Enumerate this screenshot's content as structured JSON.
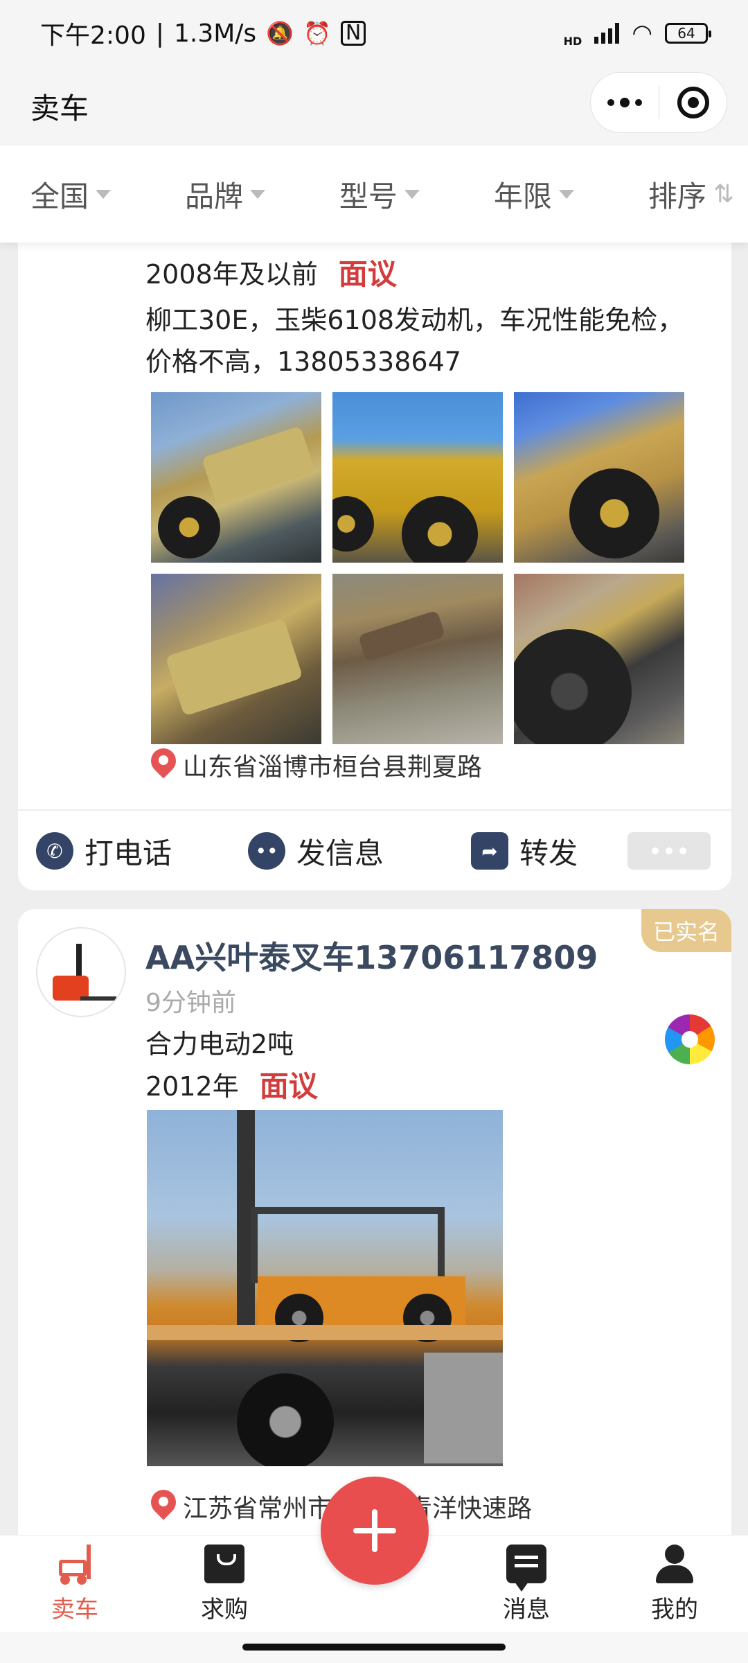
{
  "status_bar": {
    "time": "下午2:00",
    "speed": "1.3M/s",
    "hd": "HD",
    "battery": "64"
  },
  "title_bar": {
    "title": "卖车"
  },
  "filters": [
    {
      "label": "全国"
    },
    {
      "label": "品牌"
    },
    {
      "label": "型号"
    },
    {
      "label": "年限"
    },
    {
      "label": "排序"
    }
  ],
  "listings": [
    {
      "year": "2008年及以前",
      "price": "面议",
      "description": "柳工30E，玉柴6108发动机，车况性能免检，价格不高，13805338647",
      "location": "山东省淄博市桓台县荆夏路",
      "actions": {
        "call": "打电话",
        "message": "发信息",
        "share": "转发"
      }
    },
    {
      "badge": "已实名",
      "seller": "AA兴叶泰叉车13706117809",
      "time": "9分钟前",
      "model": "合力电动2吨",
      "year": "2012年",
      "price": "面议",
      "location": "江苏省常州市武进区青洋快速路"
    }
  ],
  "tab_bar": [
    {
      "label": "卖车",
      "icon": "forklift-icon",
      "active": true
    },
    {
      "label": "求购",
      "icon": "bag-icon"
    },
    {
      "label": "消息",
      "icon": "message-icon"
    },
    {
      "label": "我的",
      "icon": "user-icon"
    }
  ],
  "colors": {
    "accent": "#e35d4e",
    "price": "#d23c3c",
    "fab": "#e84e4e",
    "badge": "#e7c98f"
  }
}
